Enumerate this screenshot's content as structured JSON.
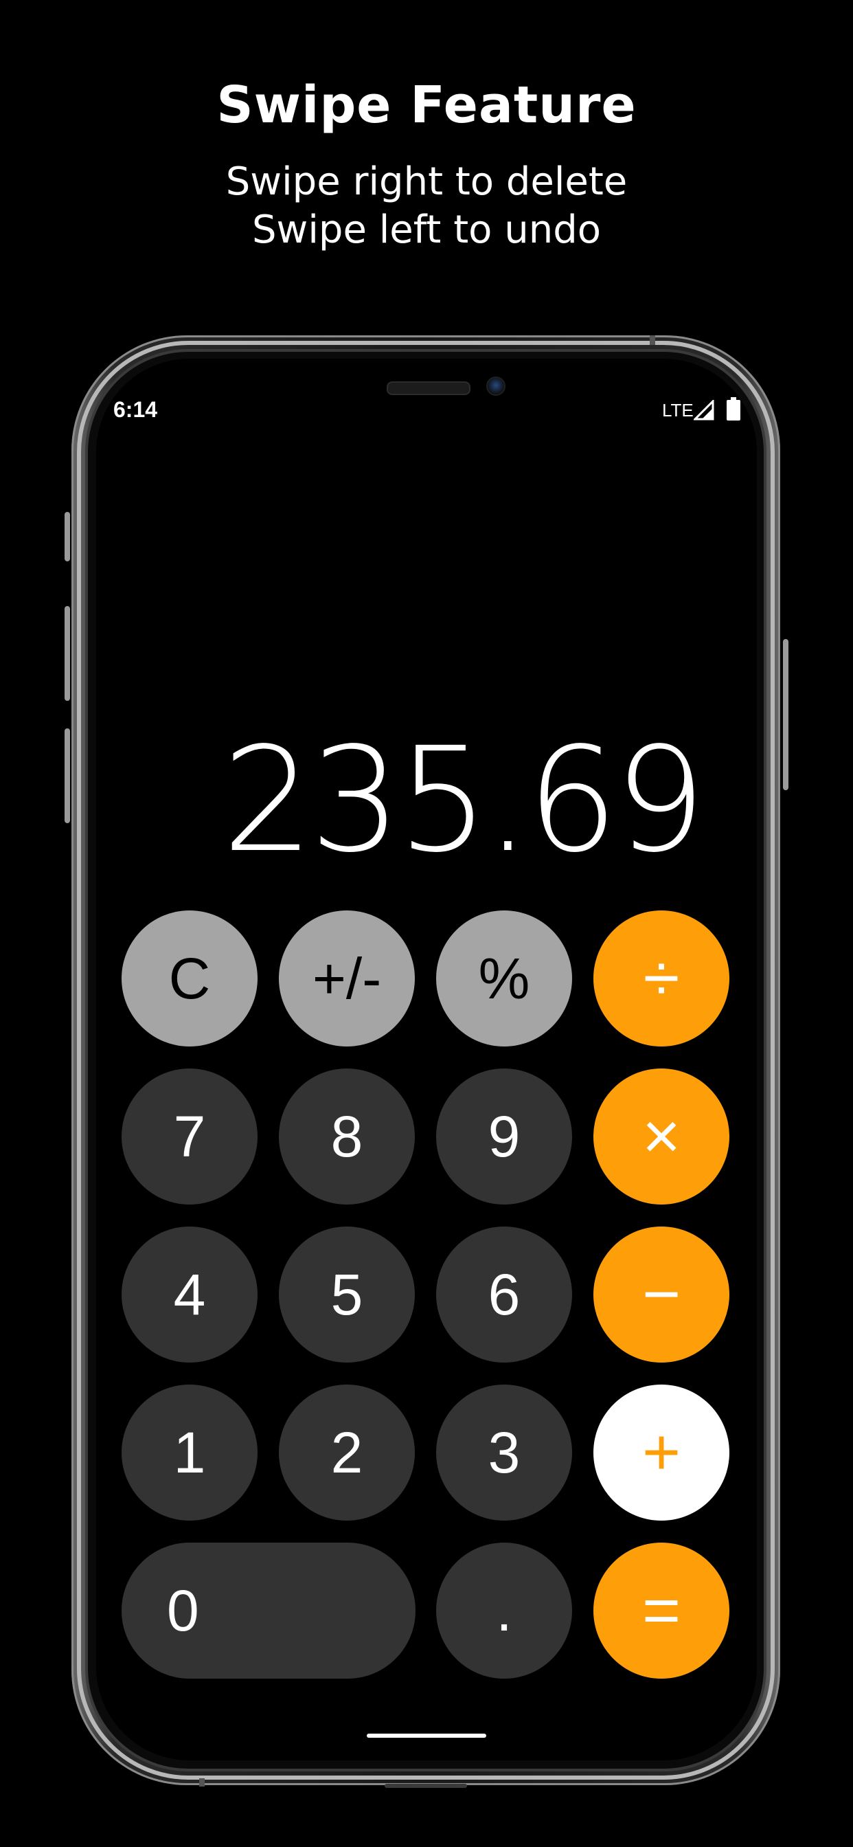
{
  "promo": {
    "title": "Swipe Feature",
    "line1": "Swipe right to delete",
    "line2": "Swipe left to undo"
  },
  "status_bar": {
    "time": "6:14",
    "network": "LTE",
    "icons": [
      "signal-icon",
      "battery-icon"
    ]
  },
  "display": {
    "value": "235.69"
  },
  "keypad": {
    "rows": [
      [
        {
          "label": "C",
          "kind": "function"
        },
        {
          "label": "+/-",
          "kind": "function"
        },
        {
          "label": "%",
          "kind": "function"
        },
        {
          "label": "÷",
          "kind": "operator"
        }
      ],
      [
        {
          "label": "7",
          "kind": "number"
        },
        {
          "label": "8",
          "kind": "number"
        },
        {
          "label": "9",
          "kind": "number"
        },
        {
          "label": "×",
          "kind": "operator"
        }
      ],
      [
        {
          "label": "4",
          "kind": "number"
        },
        {
          "label": "5",
          "kind": "number"
        },
        {
          "label": "6",
          "kind": "number"
        },
        {
          "label": "−",
          "kind": "operator"
        }
      ],
      [
        {
          "label": "1",
          "kind": "number"
        },
        {
          "label": "2",
          "kind": "number"
        },
        {
          "label": "3",
          "kind": "number"
        },
        {
          "label": "+",
          "kind": "operator-active"
        }
      ],
      [
        {
          "label": "0",
          "kind": "number-wide"
        },
        {
          "label": ".",
          "kind": "number"
        },
        {
          "label": "=",
          "kind": "operator"
        }
      ]
    ]
  },
  "colors": {
    "background": "#000000",
    "function_key": "#a5a5a5",
    "number_key": "#333333",
    "operator_key": "#fe9f0a",
    "active_operator_key": "#ffffff"
  }
}
